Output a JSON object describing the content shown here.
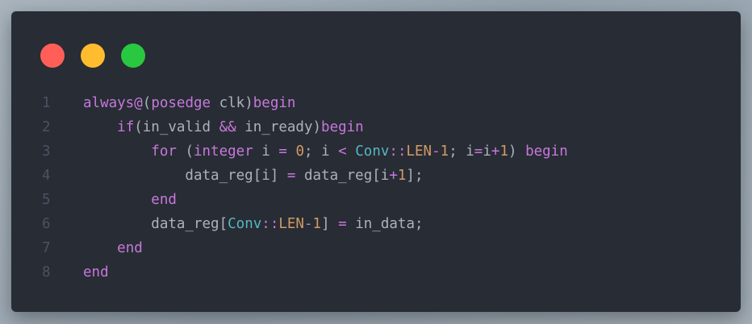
{
  "window_controls": {
    "close_color": "#ff5f57",
    "minimize_color": "#febc2e",
    "maximize_color": "#28c840"
  },
  "colors": {
    "background": "#282c34",
    "keyword": "#c678dd",
    "number": "#d19a66",
    "type": "#56b6c2",
    "text": "#abb2bf",
    "line_number": "#4b5263"
  },
  "code": {
    "language": "verilog",
    "lines": [
      {
        "number": "1",
        "tokens": [
          {
            "text": "always@",
            "kind": "keyword"
          },
          {
            "text": "(",
            "kind": "plain"
          },
          {
            "text": "posedge",
            "kind": "keyword"
          },
          {
            "text": " clk)",
            "kind": "plain"
          },
          {
            "text": "begin",
            "kind": "keyword"
          }
        ]
      },
      {
        "number": "2",
        "tokens": [
          {
            "text": "    ",
            "kind": "plain"
          },
          {
            "text": "if",
            "kind": "keyword"
          },
          {
            "text": "(in_valid ",
            "kind": "plain"
          },
          {
            "text": "&&",
            "kind": "keyword"
          },
          {
            "text": " in_ready)",
            "kind": "plain"
          },
          {
            "text": "begin",
            "kind": "keyword"
          }
        ]
      },
      {
        "number": "3",
        "tokens": [
          {
            "text": "        ",
            "kind": "plain"
          },
          {
            "text": "for",
            "kind": "keyword"
          },
          {
            "text": " (",
            "kind": "plain"
          },
          {
            "text": "integer",
            "kind": "keyword"
          },
          {
            "text": " i ",
            "kind": "plain"
          },
          {
            "text": "=",
            "kind": "keyword"
          },
          {
            "text": " ",
            "kind": "plain"
          },
          {
            "text": "0",
            "kind": "number"
          },
          {
            "text": "; i ",
            "kind": "plain"
          },
          {
            "text": "<",
            "kind": "keyword"
          },
          {
            "text": " ",
            "kind": "plain"
          },
          {
            "text": "Conv",
            "kind": "type"
          },
          {
            "text": "::",
            "kind": "keyword"
          },
          {
            "text": "LEN",
            "kind": "const"
          },
          {
            "text": "-",
            "kind": "keyword"
          },
          {
            "text": "1",
            "kind": "number"
          },
          {
            "text": "; i",
            "kind": "plain"
          },
          {
            "text": "=",
            "kind": "keyword"
          },
          {
            "text": "i",
            "kind": "plain"
          },
          {
            "text": "+",
            "kind": "keyword"
          },
          {
            "text": "1",
            "kind": "number"
          },
          {
            "text": ") ",
            "kind": "plain"
          },
          {
            "text": "begin",
            "kind": "keyword"
          }
        ]
      },
      {
        "number": "4",
        "tokens": [
          {
            "text": "            data_reg[i] ",
            "kind": "plain"
          },
          {
            "text": "=",
            "kind": "keyword"
          },
          {
            "text": " data_reg[i",
            "kind": "plain"
          },
          {
            "text": "+",
            "kind": "keyword"
          },
          {
            "text": "1",
            "kind": "number"
          },
          {
            "text": "];",
            "kind": "plain"
          }
        ]
      },
      {
        "number": "5",
        "tokens": [
          {
            "text": "        ",
            "kind": "plain"
          },
          {
            "text": "end",
            "kind": "keyword"
          }
        ]
      },
      {
        "number": "6",
        "tokens": [
          {
            "text": "        data_reg[",
            "kind": "plain"
          },
          {
            "text": "Conv",
            "kind": "type"
          },
          {
            "text": "::",
            "kind": "keyword"
          },
          {
            "text": "LEN",
            "kind": "const"
          },
          {
            "text": "-",
            "kind": "keyword"
          },
          {
            "text": "1",
            "kind": "number"
          },
          {
            "text": "] ",
            "kind": "plain"
          },
          {
            "text": "=",
            "kind": "keyword"
          },
          {
            "text": " in_data;",
            "kind": "plain"
          }
        ]
      },
      {
        "number": "7",
        "tokens": [
          {
            "text": "    ",
            "kind": "plain"
          },
          {
            "text": "end",
            "kind": "keyword"
          }
        ]
      },
      {
        "number": "8",
        "tokens": [
          {
            "text": "end",
            "kind": "keyword"
          }
        ]
      }
    ]
  }
}
